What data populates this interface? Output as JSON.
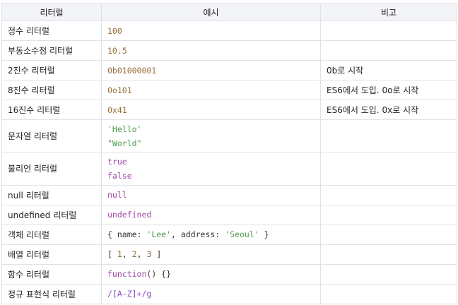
{
  "headers": {
    "literal": "리터럴",
    "example": "예시",
    "note": "비고"
  },
  "rows": [
    {
      "name": "정수 리터럴",
      "example": [
        [
          [
            "100",
            "num"
          ]
        ]
      ],
      "note": ""
    },
    {
      "name": "부동소수점 리터럴",
      "example": [
        [
          [
            "10.5",
            "num"
          ]
        ]
      ],
      "note": ""
    },
    {
      "name": "2진수 리터럴",
      "example": [
        [
          [
            "0b01000001",
            "num"
          ]
        ]
      ],
      "note": "0b로 시작"
    },
    {
      "name": "8진수 리터럴",
      "example": [
        [
          [
            "0o101",
            "num"
          ]
        ]
      ],
      "note": "ES6에서 도입. 0o로 시작"
    },
    {
      "name": "16진수 리터럴",
      "example": [
        [
          [
            "0x41",
            "num"
          ]
        ]
      ],
      "note": "ES6에서 도입. 0x로 시작"
    },
    {
      "name": "문자열 리터럴",
      "example": [
        [
          [
            "'Hello'",
            "str"
          ]
        ],
        [
          [
            "\"World\"",
            "str"
          ]
        ]
      ],
      "note": ""
    },
    {
      "name": "불리언 리터럴",
      "example": [
        [
          [
            "true",
            "kw"
          ]
        ],
        [
          [
            "false",
            "kw"
          ]
        ]
      ],
      "note": ""
    },
    {
      "name": "null 리터럴",
      "example": [
        [
          [
            "null",
            "kw"
          ]
        ]
      ],
      "note": ""
    },
    {
      "name": "undefined 리터럴",
      "example": [
        [
          [
            "undefined",
            "kw"
          ]
        ]
      ],
      "note": ""
    },
    {
      "name": "객체 리터럴",
      "example": [
        [
          [
            "{ name: ",
            "pl"
          ],
          [
            "'Lee'",
            "str"
          ],
          [
            ", address: ",
            "pl"
          ],
          [
            "'Seoul'",
            "str"
          ],
          [
            " }",
            "pl"
          ]
        ]
      ],
      "note": ""
    },
    {
      "name": "배열 리터럴",
      "example": [
        [
          [
            "[ ",
            "pl"
          ],
          [
            "1",
            "num"
          ],
          [
            ", ",
            "pl"
          ],
          [
            "2",
            "num"
          ],
          [
            ", ",
            "pl"
          ],
          [
            "3",
            "num"
          ],
          [
            " ]",
            "pl"
          ]
        ]
      ],
      "note": ""
    },
    {
      "name": "함수 리터럴",
      "example": [
        [
          [
            "function",
            "kw"
          ],
          [
            "() {}",
            "pl"
          ]
        ]
      ],
      "note": ""
    },
    {
      "name": "정규 표현식 리터럴",
      "example": [
        [
          [
            "/[A-Z]+/g",
            "rx"
          ]
        ]
      ],
      "note": ""
    }
  ],
  "colors": {
    "header_bg": "#f2f4f7",
    "border": "#dfe3e8",
    "number": "#9a6e3a",
    "string": "#4f9a4f",
    "keyword": "#a04aa6",
    "regex": "#8d4ec0"
  }
}
